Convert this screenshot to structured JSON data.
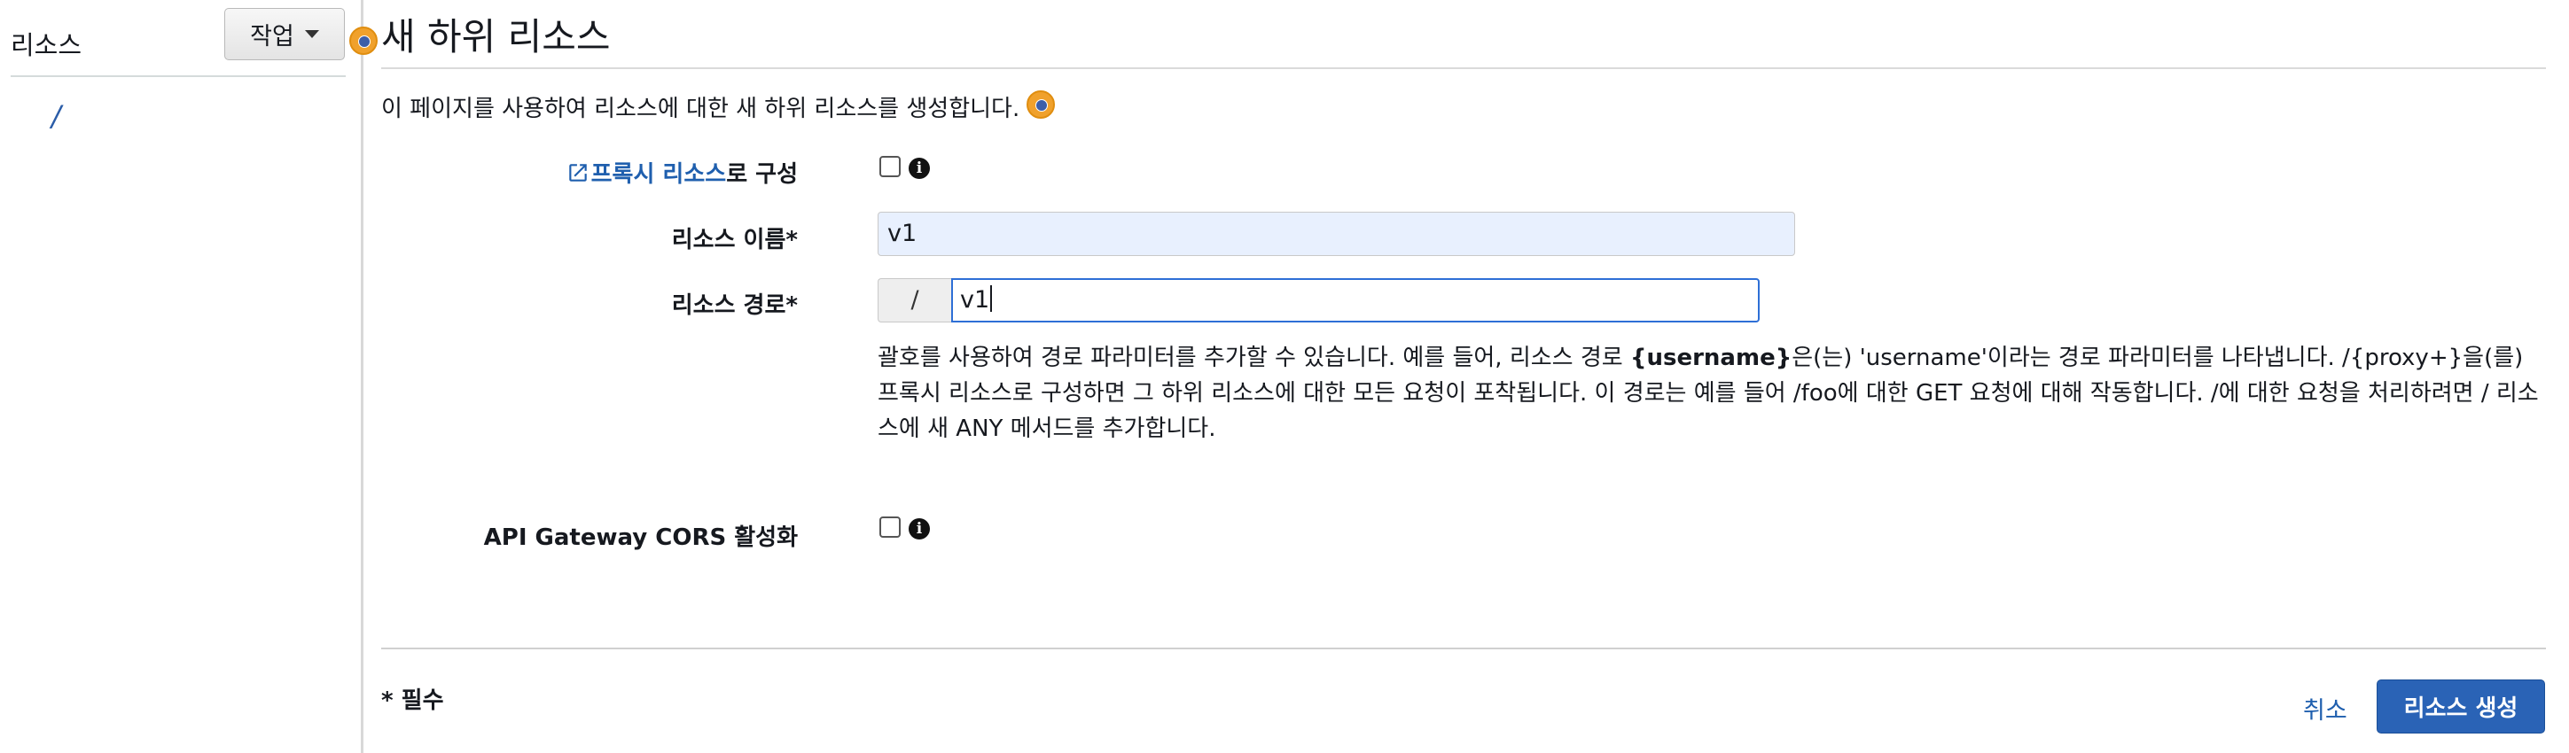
{
  "sidebar": {
    "title": "리소스",
    "actions_label": "작업",
    "tree": [
      {
        "label": "/"
      }
    ]
  },
  "main": {
    "title": "새 하위 리소스",
    "intro": "이 페이지를 사용하여 리소스에 대한 새 하위 리소스를 생성합니다.",
    "proxy": {
      "link_text": "프록시 리소스",
      "suffix": "로 구성",
      "checked": false
    },
    "resource_name": {
      "label": "리소스 이름*",
      "value": "v1"
    },
    "resource_path": {
      "label": "리소스 경로*",
      "prefix": "/",
      "value": "v1",
      "help_1": "괄호를 사용하여 경로 파라미터를 추가할 수 있습니다. 예를 들어, 리소스 경로 ",
      "help_bold": "{username}",
      "help_2": "은(는) 'username'이라는 경로 파라미터를 나타냅니다. /{proxy+}을(를) 프록시 리소스로 구성하면 그 하위 리소스에 대한 모든 요청이 포착됩니다. 이 경로는 예를 들어 /foo에 대한 GET 요청에 대해 작동합니다. /에 대한 요청을 처리하려면 / 리소스에 새 ANY 메서드를 추가합니다."
    },
    "cors": {
      "label": "API Gateway CORS 활성화",
      "checked": false
    },
    "required_note": "* 필수",
    "cancel_label": "취소",
    "create_label": "리소스 생성"
  },
  "colors": {
    "link": "#1f5fae",
    "primary_button": "#2a63b6",
    "autofill_bg": "#e8f0fe",
    "focus_border": "#2e6fd6"
  },
  "icons": [
    "caret-down-icon",
    "external-link-icon",
    "info-icon",
    "hotspot-marker-icon"
  ]
}
